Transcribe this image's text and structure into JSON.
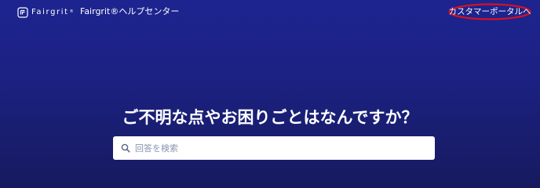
{
  "header": {
    "brand_name": "Fairgrit",
    "brand_mark": "®",
    "help_center_label": "Fairgrit®ヘルプセンター",
    "portal_link_label": "カスタマーポータルへ"
  },
  "hero": {
    "headline": "ご不明な点やお困りごとはなんですか？"
  },
  "search": {
    "placeholder": "回答を検索",
    "value": ""
  },
  "colors": {
    "background_top": "#1d2490",
    "background_bottom": "#161a5e",
    "text": "#ffffff",
    "annotation_ring": "#d8111f",
    "search_bg": "#ffffff",
    "placeholder_text": "#8a94b0"
  },
  "icons": {
    "logo": "fairgrit-logo-icon",
    "search": "search-icon"
  }
}
